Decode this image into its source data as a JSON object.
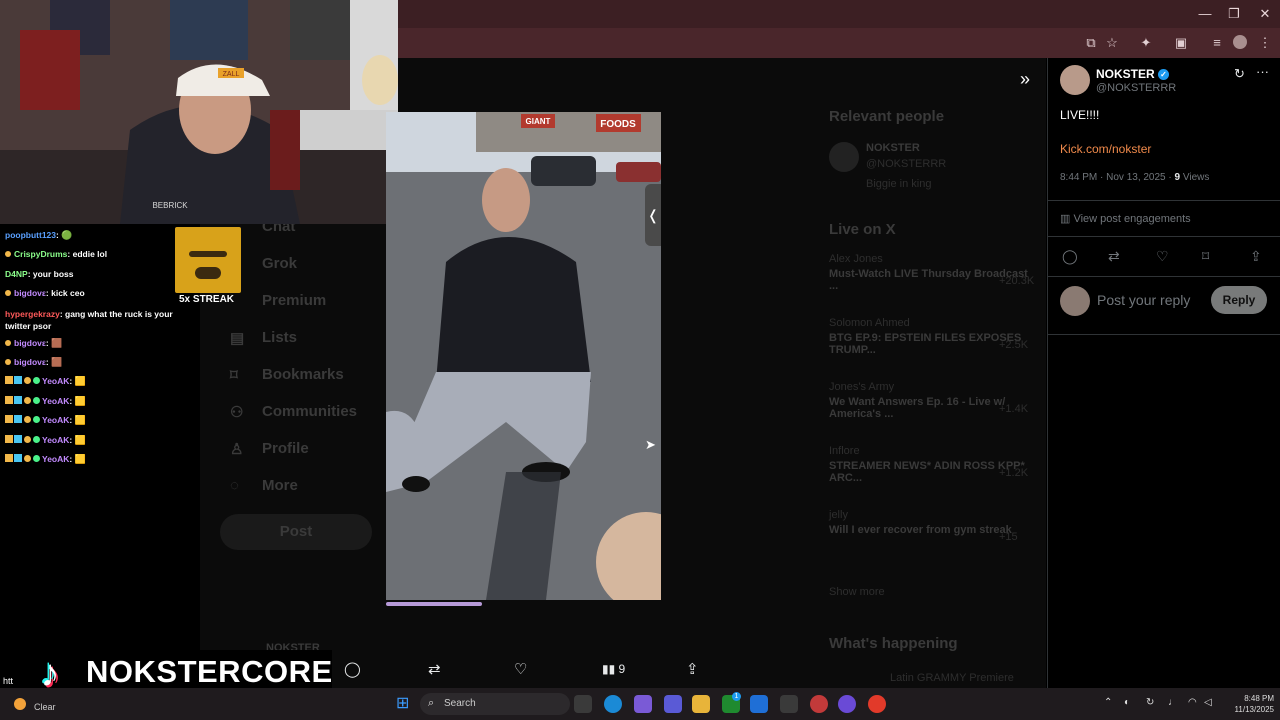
{
  "browser": {
    "window_controls": [
      "—",
      "❐",
      "✕"
    ]
  },
  "x_background": {
    "nav": [
      "Chat",
      "Grok",
      "Premium",
      "Lists",
      "Bookmarks",
      "Communities",
      "Profile",
      "More"
    ],
    "post_button": "Post",
    "relevant_people_title": "Relevant people",
    "relevant_people_name": "NOKSTER",
    "relevant_people_handle": "@NOKSTERRR",
    "relevant_people_bio": "Biggie in king",
    "live_title": "Live on X",
    "live_items": [
      {
        "author": "Alex Jones",
        "title": "Must-Watch LIVE Thursday Broadcast ...",
        "count": "+20.3K"
      },
      {
        "author": "Solomon Ahmed",
        "title": "BTG EP.9: EPSTEIN FILES EXPOSES TRUMP...",
        "count": "+2.5K"
      },
      {
        "author": "Jones's Army",
        "title": "We Want Answers Ep. 16 - Live w/ America's ...",
        "count": "+1.4K"
      },
      {
        "author": "Inflore",
        "title": "STREAMER NEWS* ADIN ROSS KPP* ARC...",
        "count": "+1.2K"
      },
      {
        "author": "jelly",
        "title": "Will I ever recover from gym streak",
        "count": "+15"
      }
    ],
    "show_more": "Show more",
    "whats_happening": "What's happening",
    "trend_partial": "Latin GRAMMY Premiere",
    "post_author_ghost": "NOKSTER"
  },
  "webcam": {
    "hat_text": "ZALL",
    "shirt_text": "BEBRICK"
  },
  "streak": {
    "label": "5x STREAK"
  },
  "chat": [
    {
      "user": "poopbutt123",
      "color": "#5aa0ff",
      "msg": "",
      "emote": "🟢"
    },
    {
      "user": "CrispyDrums",
      "color": "#8cff8c",
      "msg": "eddie lol",
      "dot": "#f2b84a"
    },
    {
      "user": "D4NP",
      "color": "#8cff8c",
      "msg": "your boss",
      "badge": "🟩"
    },
    {
      "user": "bigdovε",
      "color": "#c38bff",
      "msg": "kick ceo",
      "dot": "#f2b84a"
    },
    {
      "user": "hypergekrazy",
      "color": "#ff5a5a",
      "msg": "gang what the ruck is your twitter psor"
    },
    {
      "user": "bigdovε",
      "color": "#c38bff",
      "msg": "",
      "emote": "🟫",
      "dot": "#f2b84a"
    },
    {
      "user": "bigdovε",
      "color": "#c38bff",
      "msg": "",
      "emote": "🟫",
      "dot": "#f2b84a"
    },
    {
      "user": "YeoAK",
      "color": "#c38bff",
      "msg": "",
      "emote": "🟨",
      "badges": true
    },
    {
      "user": "YeoAK",
      "color": "#c38bff",
      "msg": "",
      "emote": "🟨",
      "badges": true
    },
    {
      "user": "YeoAK",
      "color": "#c38bff",
      "msg": "",
      "emote": "🟨",
      "badges": true
    },
    {
      "user": "YeoAK",
      "color": "#c38bff",
      "msg": "",
      "emote": "🟨",
      "badges": true
    },
    {
      "user": "YeoAK",
      "color": "#c38bff",
      "msg": "",
      "emote": "🟨",
      "badges": true
    }
  ],
  "photo": {
    "store_sign": "FOODS",
    "store_sign2": "GIANT"
  },
  "post_actions": {
    "views_count": "9"
  },
  "branding": {
    "name": "NOKSTERCORE",
    "url_stub": "htt"
  },
  "panel": {
    "author_name": "NOKSTER",
    "author_handle": "@NOKSTERRR",
    "post_text": "LIVE!!!!",
    "link": "Kick.com/nokster",
    "time": "8:44 PM · Nov 13, 2025 · ",
    "views_count": "9",
    "views_label": " Views",
    "engagements": "View post engagements",
    "reply_placeholder": "Post your reply",
    "reply_button": "Reply",
    "accent": "#1d9bf0",
    "link_color": "#f08a4b"
  },
  "taskbar": {
    "weather": "Clear",
    "search_placeholder": "Search",
    "time": "8:48 PM",
    "date": "11/13/2025",
    "badge_count": "1"
  }
}
